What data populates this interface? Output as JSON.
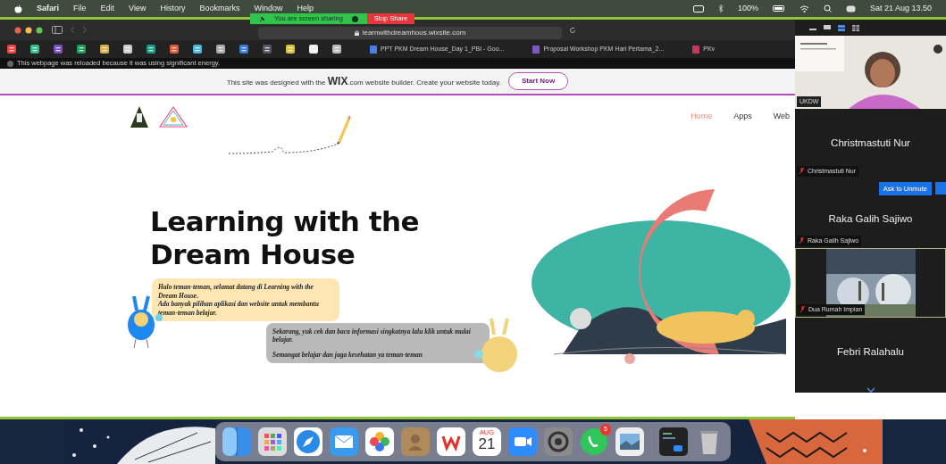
{
  "menu_bar": {
    "apps": [
      "Safari",
      "File",
      "Edit",
      "View",
      "History",
      "Bookmarks",
      "Window",
      "Help"
    ],
    "battery": "100%",
    "clock": "Sat 21 Aug 13.50"
  },
  "screen_share": {
    "status": "You are screen sharing",
    "stop_button": "Stop Share"
  },
  "browser": {
    "url": "learnwithdreamhous.wixsite.com",
    "bookmarks": [
      {
        "kind": "gmail"
      },
      {
        "kind": "drive"
      },
      {
        "kind": "forms"
      },
      {
        "kind": "sheets"
      },
      {
        "kind": "hat"
      },
      {
        "kind": "file"
      },
      {
        "kind": "shield"
      },
      {
        "kind": "mail"
      },
      {
        "kind": "square"
      },
      {
        "kind": "doc"
      },
      {
        "kind": "cloud"
      },
      {
        "kind": "line"
      },
      {
        "kind": "note"
      },
      {
        "kind": "chart"
      },
      {
        "kind": "download"
      }
    ],
    "tabs": [
      {
        "title": "PPT PKM Dream House_Day 1_PBI - Goo..."
      },
      {
        "title": "Proposal Workshop PKM Hari Pertama_2..."
      },
      {
        "title": "PKv"
      }
    ],
    "notice": "This webpage was reloaded because it was using significant energy."
  },
  "wix_banner": {
    "text": "This site was designed with the **WIX**.com website builder. Create your website today.",
    "button": "Start Now"
  },
  "website": {
    "nav": [
      {
        "label": "Home",
        "selected": true
      },
      {
        "label": "Apps",
        "selected": false
      },
      {
        "label": "Web",
        "selected": false
      }
    ],
    "heading": "Learning with the Dream House",
    "bubbles": [
      {
        "color": "#fde6b2",
        "paragraphs": [
          "Halo teman-teman, selamat datang di Learning with the Dream House.",
          "Ada banyak pilihan aplikasi dan website untuk membantu teman-teman belajar."
        ]
      },
      {
        "color": "#b9b9b9",
        "paragraphs": [
          "Sekarang, yuk cek dan baca informasi singkatnya lalu klik untuk mulai belajar.",
          "Semangat belajar dan jaga kesehatan ya teman-teman"
        ]
      }
    ]
  },
  "zoom_panel": {
    "tiles": [
      {
        "kind": "video",
        "label": "UKDW"
      },
      {
        "kind": "name",
        "name": "Christmastuti Nur",
        "label": "Christmastuti Nur",
        "muted": true
      },
      {
        "kind": "name",
        "name": "Raka Galih Sajiwo",
        "label": "Raka Galih Sajiwo",
        "muted": true,
        "action": "Ask to Unmute"
      },
      {
        "kind": "screen",
        "label": "Dua Rumah Impian",
        "muted": true
      },
      {
        "kind": "name",
        "name": "Febri Ralahalu"
      }
    ]
  },
  "dock": {
    "apps": [
      {
        "kind": "finder"
      },
      {
        "kind": "launchpad"
      },
      {
        "kind": "safari"
      },
      {
        "kind": "mail"
      },
      {
        "kind": "photos"
      },
      {
        "kind": "contacts"
      },
      {
        "kind": "wps"
      },
      {
        "kind": "calendar",
        "month": "AUG",
        "day": "21"
      },
      {
        "kind": "zoom"
      },
      {
        "kind": "settings"
      },
      {
        "kind": "whatsapp",
        "badge": "5"
      },
      {
        "kind": "preview"
      },
      {
        "kind": "divider"
      },
      {
        "kind": "zoomwin"
      },
      {
        "kind": "trash"
      }
    ]
  }
}
